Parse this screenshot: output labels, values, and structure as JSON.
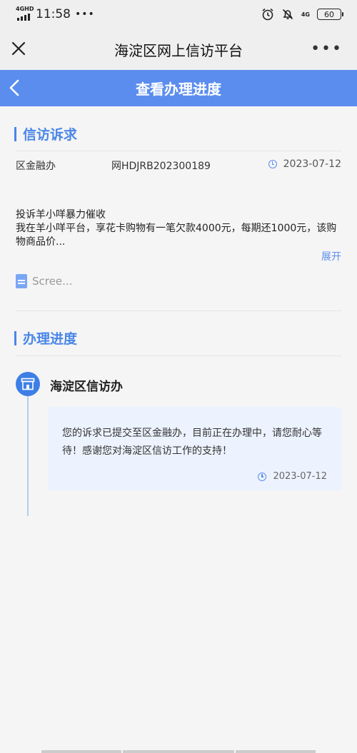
{
  "status_bar": {
    "network": "4GHD",
    "time": "11:58",
    "dots": "•••",
    "signal_right": "4G",
    "battery": "60"
  },
  "titlebar": {
    "title": "海淀区网上信访平台",
    "close_icon": "close-icon",
    "more_icon": "more-icon",
    "more": "•••"
  },
  "header": {
    "title": "查看办理进度",
    "back_icon": "chevron-left-icon"
  },
  "petition": {
    "section_title": "信访诉求",
    "department": "区金融办",
    "code": "网HDJRB202300189",
    "date": "2023-07-12",
    "subject": "投诉羊小咩暴力催收",
    "content": "我在羊小咩平台，享花卡购物有一笔欠款4000元，每期还1000元，该购物商品价...",
    "expand_label": "展开",
    "attachment_name": "Scree..."
  },
  "progress": {
    "section_title": "办理进度",
    "office_name": "海淀区信访办",
    "message": "您的诉求已提交至区金融办，目前正在办理中，请您耐心等待！感谢您对海淀区信访工作的支持！",
    "date": "2023-07-12"
  },
  "colors": {
    "accent": "#5b8def",
    "section_accent": "#4a86e8",
    "message_bg": "#ecf3fe"
  }
}
